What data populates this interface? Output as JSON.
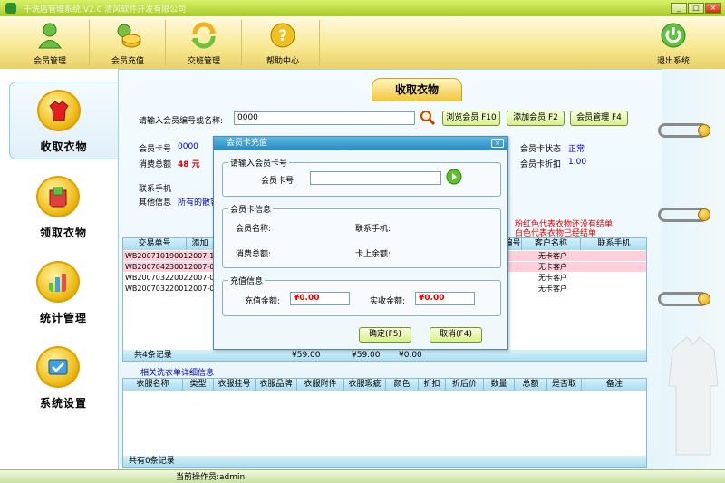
{
  "window": {
    "title": "干洗店管理系统 V2.0 清风软件开发有限公司",
    "min": "_",
    "max": "□",
    "close": "×"
  },
  "toolbar": [
    {
      "label": "会员管理",
      "icon": "member-icon"
    },
    {
      "label": "会员充值",
      "icon": "recharge-icon"
    },
    {
      "label": "交班管理",
      "icon": "shift-icon"
    },
    {
      "label": "帮助中心",
      "icon": "help-icon"
    },
    {
      "label": "退出系统",
      "icon": "power-icon"
    }
  ],
  "nav": [
    {
      "label": "收取衣物",
      "icon": "clothes-receive-icon"
    },
    {
      "label": "领取衣物",
      "icon": "clothes-pickup-icon"
    },
    {
      "label": "统计管理",
      "icon": "statistics-icon"
    },
    {
      "label": "系统设置",
      "icon": "settings-icon"
    }
  ],
  "page": {
    "title": "收取衣物"
  },
  "search": {
    "label": "请输入会员编号或名称:",
    "value": "0000",
    "browse": "浏览会员 F10",
    "add": "添加会员 F2",
    "manage": "会员管理 F4"
  },
  "member": {
    "card_label": "会员卡号",
    "card_value": "0000",
    "total_label": "消费总额",
    "total_value": "48 元",
    "phone_label": "联系手机",
    "other_label": "其他信息",
    "other_value": "所有的散客",
    "status_label": "会员卡状态",
    "status_value": "正常",
    "discount_label": "会员卡折扣",
    "discount_value": "1.00"
  },
  "legend": {
    "line1": "粉红色代表衣物还没有结单,",
    "line2": "白色代表衣物已经结单"
  },
  "orders": {
    "headers": [
      "交易单号",
      "添加",
      "编号",
      "客户名称",
      "联系手机"
    ],
    "rows": [
      {
        "id": "WB20071019001",
        "date": "2007-10",
        "name": "无卡客户",
        "pink": true
      },
      {
        "id": "WB20070423001",
        "date": "2007-04",
        "name": "无卡客户",
        "pink": true
      },
      {
        "id": "WB20070322002",
        "date": "2007-03",
        "name": "无卡客户",
        "pink": false
      },
      {
        "id": "WB20070322001",
        "date": "2007-03",
        "name": "无卡客户",
        "pink": false
      }
    ],
    "footer": {
      "count": "共4条记录",
      "sum1": "¥59.00",
      "sum2": "¥59.00",
      "sum3": "¥0.00"
    }
  },
  "details": {
    "title": "相关洗衣单详细信息",
    "headers": [
      "衣服名称",
      "类型",
      "衣服挂号",
      "衣服品牌",
      "衣服附件",
      "衣服瑕疵",
      "颜色",
      "折扣",
      "折后价",
      "数量",
      "总额",
      "是否取",
      "备注"
    ],
    "footer": "共有0条记录"
  },
  "dialog": {
    "title": "会员卡充值",
    "close": "×",
    "group1": "请输入会员卡号",
    "card_label": "会员卡号:",
    "group2": "会员卡信息",
    "name_label": "会员名称:",
    "phone_label": "联系手机:",
    "total_label": "消费总额:",
    "balance_label": "卡上余额:",
    "group3": "充值信息",
    "recharge_label": "充值金额:",
    "recharge_value": "¥0.00",
    "actual_label": "实收金额:",
    "actual_value": "¥0.00",
    "ok": "确定(F5)",
    "cancel": "取消(F4)"
  },
  "status": {
    "operator": "当前操作员:admin"
  },
  "colors": {
    "accent": "#f0c020",
    "title": "#a6cc2b",
    "pink_row": "#ffd0dc"
  }
}
